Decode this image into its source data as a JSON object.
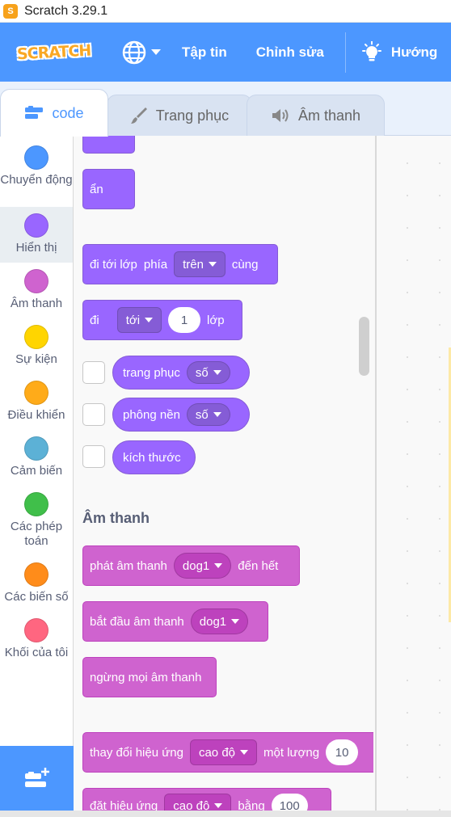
{
  "window": {
    "title": "Scratch 3.29.1"
  },
  "menu": {
    "logo": "SCRATCH",
    "file": "Tập tin",
    "edit": "Chỉnh sửa",
    "tutorials": "Hướng"
  },
  "tabs": [
    {
      "label": "code"
    },
    {
      "label": "Trang phục"
    },
    {
      "label": "Âm thanh"
    }
  ],
  "categories": [
    {
      "label": "Chuyển động",
      "color": "#4c97ff"
    },
    {
      "label": "Hiển thị",
      "color": "#9966ff"
    },
    {
      "label": "Âm thanh",
      "color": "#cf63cf"
    },
    {
      "label": "Sự kiện",
      "color": "#ffd500"
    },
    {
      "label": "Điều khiển",
      "color": "#ffab19"
    },
    {
      "label": "Cảm biến",
      "color": "#5cb1d6"
    },
    {
      "label": "Các phép toán",
      "color": "#40bf4a"
    },
    {
      "label": "Các biến số",
      "color": "#ff8c1a"
    },
    {
      "label": "Khối của tôi",
      "color": "#ff6680"
    }
  ],
  "blocks": {
    "hide": "ẩn",
    "goto_layer": {
      "t1": "đi tới lớp",
      "t2": "phía",
      "dropdown": "trên",
      "t3": "cùng"
    },
    "go_layers": {
      "t1": "đi",
      "dropdown": "tới",
      "value": "1",
      "t2": "lớp"
    },
    "costume": {
      "label": "trang phục",
      "dropdown": "số"
    },
    "backdrop": {
      "label": "phông nền",
      "dropdown": "số"
    },
    "size": {
      "label": "kích thước"
    },
    "sound_section": "Âm thanh",
    "play_until_done": {
      "t1": "phát âm thanh",
      "dropdown": "dog1",
      "t2": "đến hết"
    },
    "start_sound": {
      "t1": "bắt đầu âm thanh",
      "dropdown": "dog1"
    },
    "stop_all": "ngừng mọi âm thanh",
    "change_effect": {
      "t1": "thay đổi hiệu ứng",
      "dropdown": "cao độ",
      "t2": "một lượng",
      "value": "10"
    },
    "set_effect": {
      "t1": "đặt hiệu ứng",
      "dropdown": "cao độ",
      "t2": "bằng",
      "value": "100"
    }
  }
}
